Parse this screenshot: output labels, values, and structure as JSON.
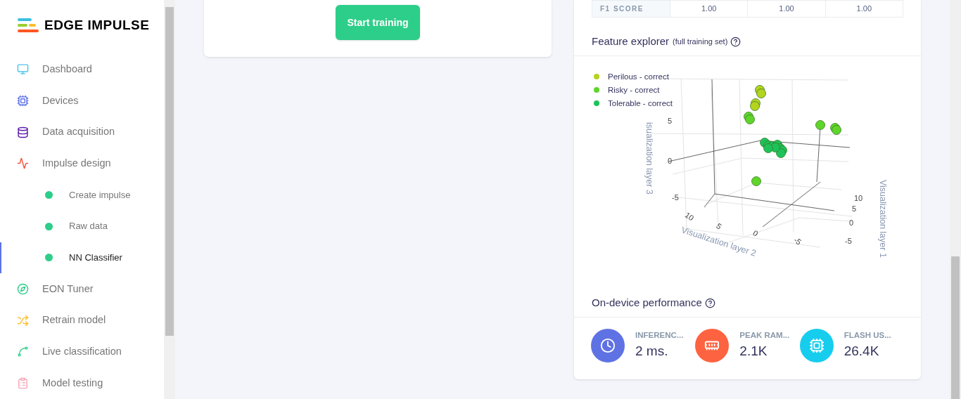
{
  "brand": {
    "name": "EDGE IMPULSE"
  },
  "sidebar": {
    "items": [
      {
        "kind": "main",
        "label": "Dashboard",
        "selected": false
      },
      {
        "kind": "main",
        "label": "Devices",
        "selected": false
      },
      {
        "kind": "main",
        "label": "Data acquisition",
        "selected": false
      },
      {
        "kind": "main",
        "label": "Impulse design",
        "selected": false
      },
      {
        "kind": "sub",
        "label": "Create impulse",
        "selected": false
      },
      {
        "kind": "sub",
        "label": "Raw data",
        "selected": false
      },
      {
        "kind": "sub",
        "label": "NN Classifier",
        "selected": true
      },
      {
        "kind": "main",
        "label": "EON Tuner",
        "selected": false
      },
      {
        "kind": "main",
        "label": "Retrain model",
        "selected": false
      },
      {
        "kind": "main",
        "label": "Live classification",
        "selected": false
      },
      {
        "kind": "main",
        "label": "Model testing",
        "selected": false
      }
    ]
  },
  "training": {
    "button": "Start training"
  },
  "metrics_table": {
    "rows": [
      {
        "label": "F1 SCORE",
        "cells": [
          "1.00",
          "1.00",
          "1.00"
        ]
      }
    ]
  },
  "feature_explorer": {
    "title": "Feature explorer",
    "subtitle": "(full training set)",
    "legend": [
      {
        "label": "Perilous - correct",
        "color": "#b5d41e"
      },
      {
        "label": "Risky - correct",
        "color": "#5fd52a"
      },
      {
        "label": "Tolerable - correct",
        "color": "#1ec25a"
      }
    ],
    "axes": {
      "z_title": "isualization layer 3",
      "z_ticks": [
        "5",
        "0",
        "-5"
      ],
      "x_title": "Visualization layer 2",
      "x_ticks": [
        "10",
        "5",
        "0",
        "-5"
      ],
      "y_title": "Visualization layer 1",
      "y_ticks": [
        "10",
        "5",
        "0",
        "-5"
      ]
    }
  },
  "performance": {
    "title": "On-device performance",
    "items": [
      {
        "label": "INFERENC...",
        "value": "2 ms.",
        "color": "#5f72e4"
      },
      {
        "label": "PEAK RAM...",
        "value": "2.1K",
        "color": "#fd6340"
      },
      {
        "label": "FLASH US...",
        "value": "26.4K",
        "color": "#16cdee"
      }
    ]
  }
}
